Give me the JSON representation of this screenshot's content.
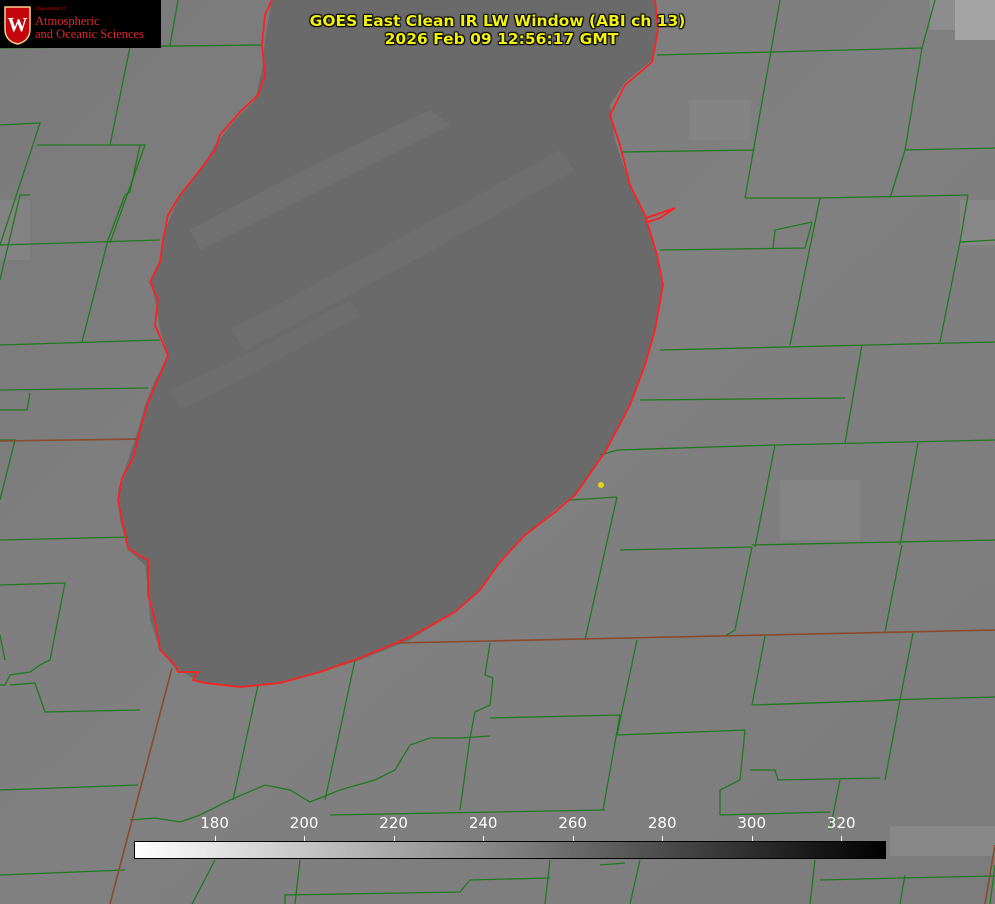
{
  "title": {
    "line1": "GOES East Clean IR LW Window (ABI ch 13)",
    "line2": "2026 Feb 09 12:56:17 GMT"
  },
  "logo": {
    "dept": "Department of",
    "line1": "Atmospheric",
    "line2": "and Oceanic Sciences",
    "seal_letter": "W"
  },
  "colorbar": {
    "min": 162,
    "max": 330,
    "ticks": [
      "180",
      "200",
      "220",
      "240",
      "260",
      "280",
      "300",
      "320"
    ],
    "color_low": "#ffffff",
    "color_high": "#000000"
  },
  "colors": {
    "county_lines": "#1f7a1f",
    "shoreline": "#ff2020",
    "state_lines": "#8b4a2b",
    "title": "#f2f20d",
    "marker": "#e6d40e",
    "lake": "#6a6a6a",
    "land": "#7d7d7d"
  }
}
